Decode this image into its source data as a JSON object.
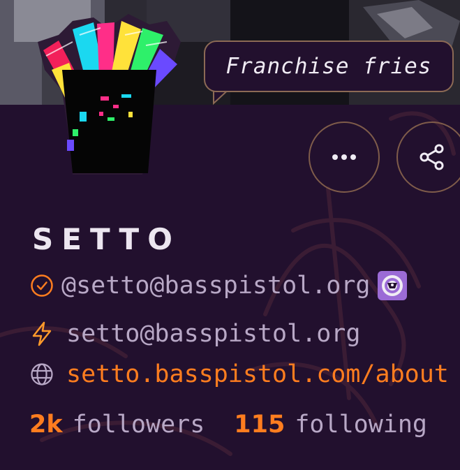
{
  "banner": {
    "status_text": "Franchise fries"
  },
  "actions": {
    "more_label": "more options",
    "share_label": "share"
  },
  "profile": {
    "display_name": "SETTO",
    "handle": "@setto@basspistol.org",
    "lightning_address": "setto@basspistol.org",
    "website": "setto.basspistol.com/about"
  },
  "stats": {
    "followers_count": "2k",
    "followers_label": "followers",
    "following_count": "115",
    "following_label": "following"
  },
  "icons": {
    "verified": "check-circle-icon",
    "lightning": "lightning-icon",
    "website": "globe-icon",
    "more": "ellipsis-icon",
    "share": "share-icon"
  },
  "colors": {
    "background": "#22102e",
    "accent": "#ff7d1f",
    "text_muted": "#b8a8c6",
    "text_light": "#ece6f0",
    "border": "#7f5c4a"
  }
}
